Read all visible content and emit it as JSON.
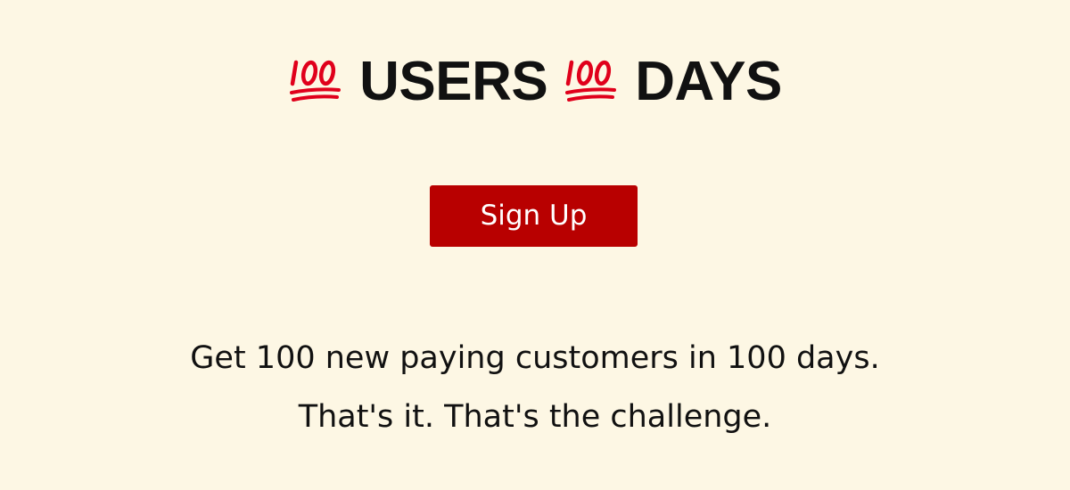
{
  "hero": {
    "icon": "hundred-points-icon",
    "word_1": "USERS",
    "word_2": "DAYS",
    "accent_color": "#e0001b"
  },
  "signup": {
    "label": "Sign Up",
    "color": "#b80000"
  },
  "tagline": {
    "line_1": "Get 100 new paying customers in 100 days.",
    "line_2": "That's it. That's the challenge."
  },
  "colors": {
    "background": "#fdf7e4",
    "text": "#111111"
  }
}
